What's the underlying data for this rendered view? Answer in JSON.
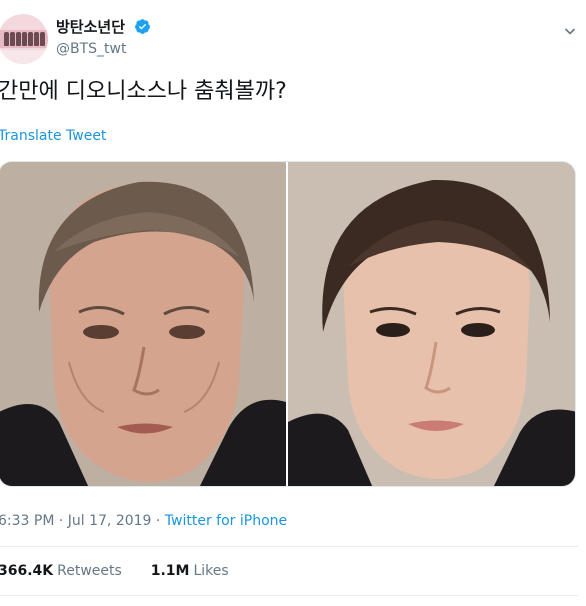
{
  "tweet": {
    "author": {
      "display_name": "방탄소년단",
      "handle": "@BTS_twt",
      "verified_icon": "verified-badge-icon",
      "avatar_icon": "avatar"
    },
    "menu_icon": "chevron-down-icon",
    "text": "간만에 디오니소스나 춤춰볼까?",
    "translate_label": "Translate Tweet",
    "timestamp": "6:33 PM · Jul 17, 2019 · ",
    "source": "Twitter for iPhone",
    "stats": {
      "retweets_count": "366.4K",
      "retweets_label": "Retweets",
      "likes_count": "1.1M",
      "likes_label": "Likes"
    },
    "colors": {
      "link": "#1b95e0",
      "secondary_text": "#657786",
      "verified": "#1da1f2"
    }
  }
}
